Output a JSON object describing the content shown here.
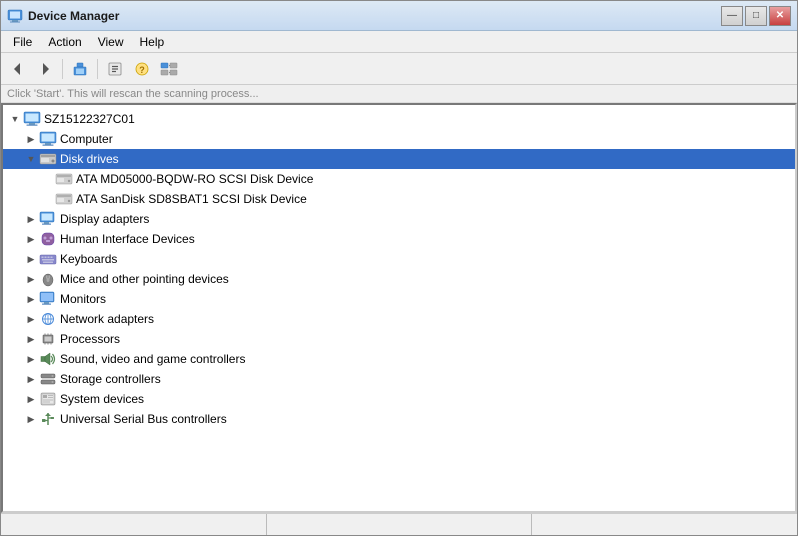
{
  "window": {
    "title": "Device Manager",
    "title_icon": "💻"
  },
  "title_bar": {
    "title": "Device Manager",
    "min_label": "—",
    "max_label": "□",
    "close_label": "✕"
  },
  "menu": {
    "items": [
      {
        "id": "file",
        "label": "File"
      },
      {
        "id": "action",
        "label": "Action"
      },
      {
        "id": "view",
        "label": "View"
      },
      {
        "id": "help",
        "label": "Help"
      }
    ]
  },
  "toolbar": {
    "buttons": [
      {
        "id": "back",
        "icon": "◀",
        "disabled": false
      },
      {
        "id": "forward",
        "icon": "▶",
        "disabled": false
      },
      {
        "id": "up",
        "icon": "⬛",
        "disabled": false
      },
      {
        "id": "show",
        "icon": "⬛",
        "disabled": false
      },
      {
        "id": "properties",
        "icon": "⬛",
        "disabled": false
      },
      {
        "id": "help2",
        "icon": "⬛",
        "disabled": false
      }
    ]
  },
  "banner": {
    "text": "Click 'Start'. This will rescan the scanning process..."
  },
  "tree": {
    "root": {
      "id": "root",
      "label": "SZ15122327C01",
      "expanded": true,
      "icon": "computer",
      "children": [
        {
          "id": "computer",
          "label": "Computer",
          "expanded": false,
          "icon": "computer",
          "children": []
        },
        {
          "id": "disk-drives",
          "label": "Disk drives",
          "expanded": true,
          "selected": true,
          "icon": "disk",
          "children": [
            {
              "id": "disk1",
              "label": "ATA MD05000-BQDW-RO SCSI Disk Device",
              "icon": "disk-item",
              "children": []
            },
            {
              "id": "disk2",
              "label": "ATA SanDisk SD8SBAT1 SCSI Disk Device",
              "icon": "disk-item",
              "children": []
            }
          ]
        },
        {
          "id": "display-adapters",
          "label": "Display adapters",
          "expanded": false,
          "icon": "display",
          "children": []
        },
        {
          "id": "human-interface",
          "label": "Human Interface Devices",
          "expanded": false,
          "icon": "hid",
          "children": []
        },
        {
          "id": "keyboards",
          "label": "Keyboards",
          "expanded": false,
          "icon": "keyboard",
          "children": []
        },
        {
          "id": "mice",
          "label": "Mice and other pointing devices",
          "expanded": false,
          "icon": "mouse",
          "children": []
        },
        {
          "id": "monitors",
          "label": "Monitors",
          "expanded": false,
          "icon": "monitor",
          "children": []
        },
        {
          "id": "network",
          "label": "Network adapters",
          "expanded": false,
          "icon": "network",
          "children": []
        },
        {
          "id": "processors",
          "label": "Processors",
          "expanded": false,
          "icon": "cpu",
          "children": []
        },
        {
          "id": "sound",
          "label": "Sound, video and game controllers",
          "expanded": false,
          "icon": "sound",
          "children": []
        },
        {
          "id": "storage",
          "label": "Storage controllers",
          "expanded": false,
          "icon": "storage",
          "children": []
        },
        {
          "id": "system",
          "label": "System devices",
          "expanded": false,
          "icon": "system",
          "children": []
        },
        {
          "id": "usb",
          "label": "Universal Serial Bus controllers",
          "expanded": false,
          "icon": "usb",
          "children": []
        }
      ]
    }
  },
  "status": {
    "sections": [
      "",
      "",
      ""
    ]
  },
  "colors": {
    "selected_bg": "#316ac5",
    "hover_bg": "#e8f0fc",
    "title_gradient_start": "#dde9f5",
    "title_gradient_end": "#c5d9f0"
  },
  "icons": {
    "computer": "🖥",
    "disk": "💾",
    "disk_item": "🔲",
    "display": "🖥",
    "hid": "🎮",
    "keyboard": "⌨",
    "mouse": "🖱",
    "monitor": "🖥",
    "network": "🌐",
    "cpu": "⚙",
    "sound": "🔊",
    "storage": "💽",
    "system": "🔧",
    "usb": "🔌",
    "toggle_expanded": "▼",
    "toggle_collapsed": "▶",
    "toggle_leaf": " "
  }
}
